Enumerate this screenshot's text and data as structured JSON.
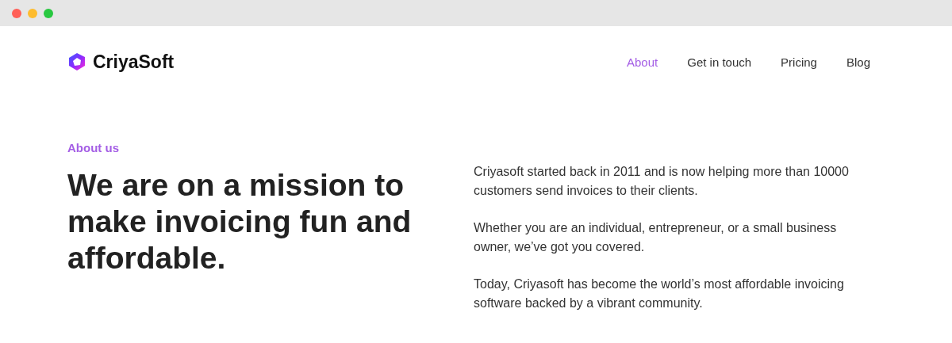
{
  "header": {
    "brand": "CriyaSoft",
    "nav": [
      {
        "label": "About",
        "selected": true
      },
      {
        "label": "Get in touch",
        "selected": false
      },
      {
        "label": "Pricing",
        "selected": false
      },
      {
        "label": "Blog",
        "selected": false
      }
    ]
  },
  "hero": {
    "eyebrow": "About us",
    "headline": "We are on a mission to make invoicing fun and affordable.",
    "paragraphs": [
      "Criyasoft started back in 2011 and is now helping more than 10000 customers send invoices to their clients.",
      "Whether you are an individual, entrepreneur, or a small business owner, we’ve got you covered.",
      "Today, Criyasoft has become the world’s most affordable invoicing software backed by a vibrant community."
    ]
  }
}
